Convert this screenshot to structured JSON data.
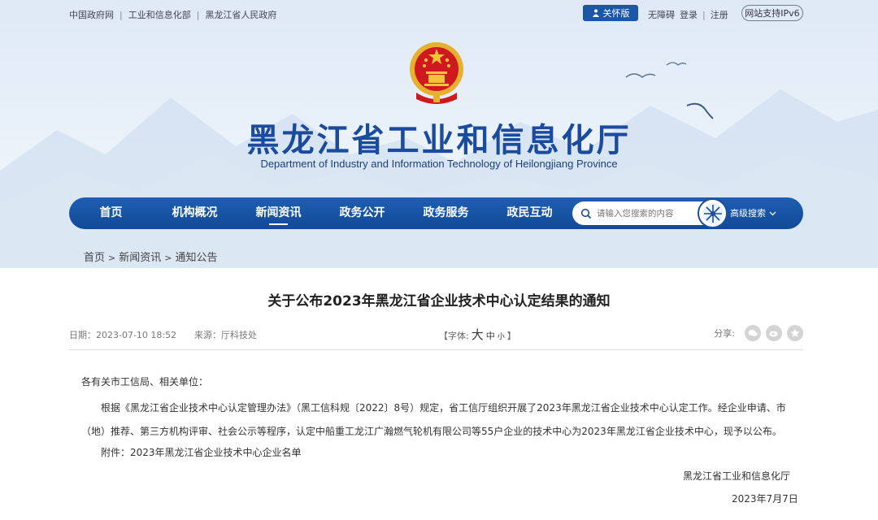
{
  "top_links": [
    "中国政府网",
    "工业和信息化部",
    "黑龙江省人民政府"
  ],
  "care_label": "关怀版",
  "right_links": [
    "无障碍",
    "登录",
    "注册"
  ],
  "ipv6": "网站支持IPv6",
  "site": {
    "title": "黑龙江省工业和信息化厅",
    "subtitle": "Department of Industry and Information Technology of Heilongjiang Province"
  },
  "nav": {
    "items": [
      "首页",
      "机构概况",
      "新闻资讯",
      "政务公开",
      "政务服务",
      "政民互动"
    ],
    "active": "新闻资讯",
    "search_placeholder": "请输入您搜索的内容",
    "advanced": "高级搜索"
  },
  "breadcrumb": [
    "首页",
    "新闻资讯",
    "通知公告"
  ],
  "article": {
    "title": "关于公布2023年黑龙江省企业技术中心认定结果的通知",
    "date": "日期：2023-07-10 18:52",
    "source": "来源：厅科技处",
    "font_open": "【字体:",
    "font_big": "大",
    "font_mid": "中",
    "font_small": "小",
    "font_close": "】",
    "share": "分享:",
    "p1": "各有关市工信局、相关单位：",
    "p2": "根据《黑龙江省企业技术中心认定管理办法》（黑工信科规〔2022〕8号）规定，省工信厅组织开展了2023年黑龙江省企业技术中心认定工作。经企业申请、市（地）推荐、第三方机构评审、社会公示等程序，认定中船重工龙江广瀚燃气轮机有限公司等55户企业的技术中心为2023年黑龙江省企业技术中心，现予以公布。",
    "p3": "附件：2023年黑龙江省企业技术中心企业名单",
    "sign_org": "黑龙江省工业和信息化厅",
    "sign_date": "2023年7月7日"
  },
  "colors": {
    "brand_blue": "#1b4b9c",
    "nav_blue": "#1a56a8",
    "emblem_red": "#d0191f",
    "gold": "#f3c43b"
  }
}
